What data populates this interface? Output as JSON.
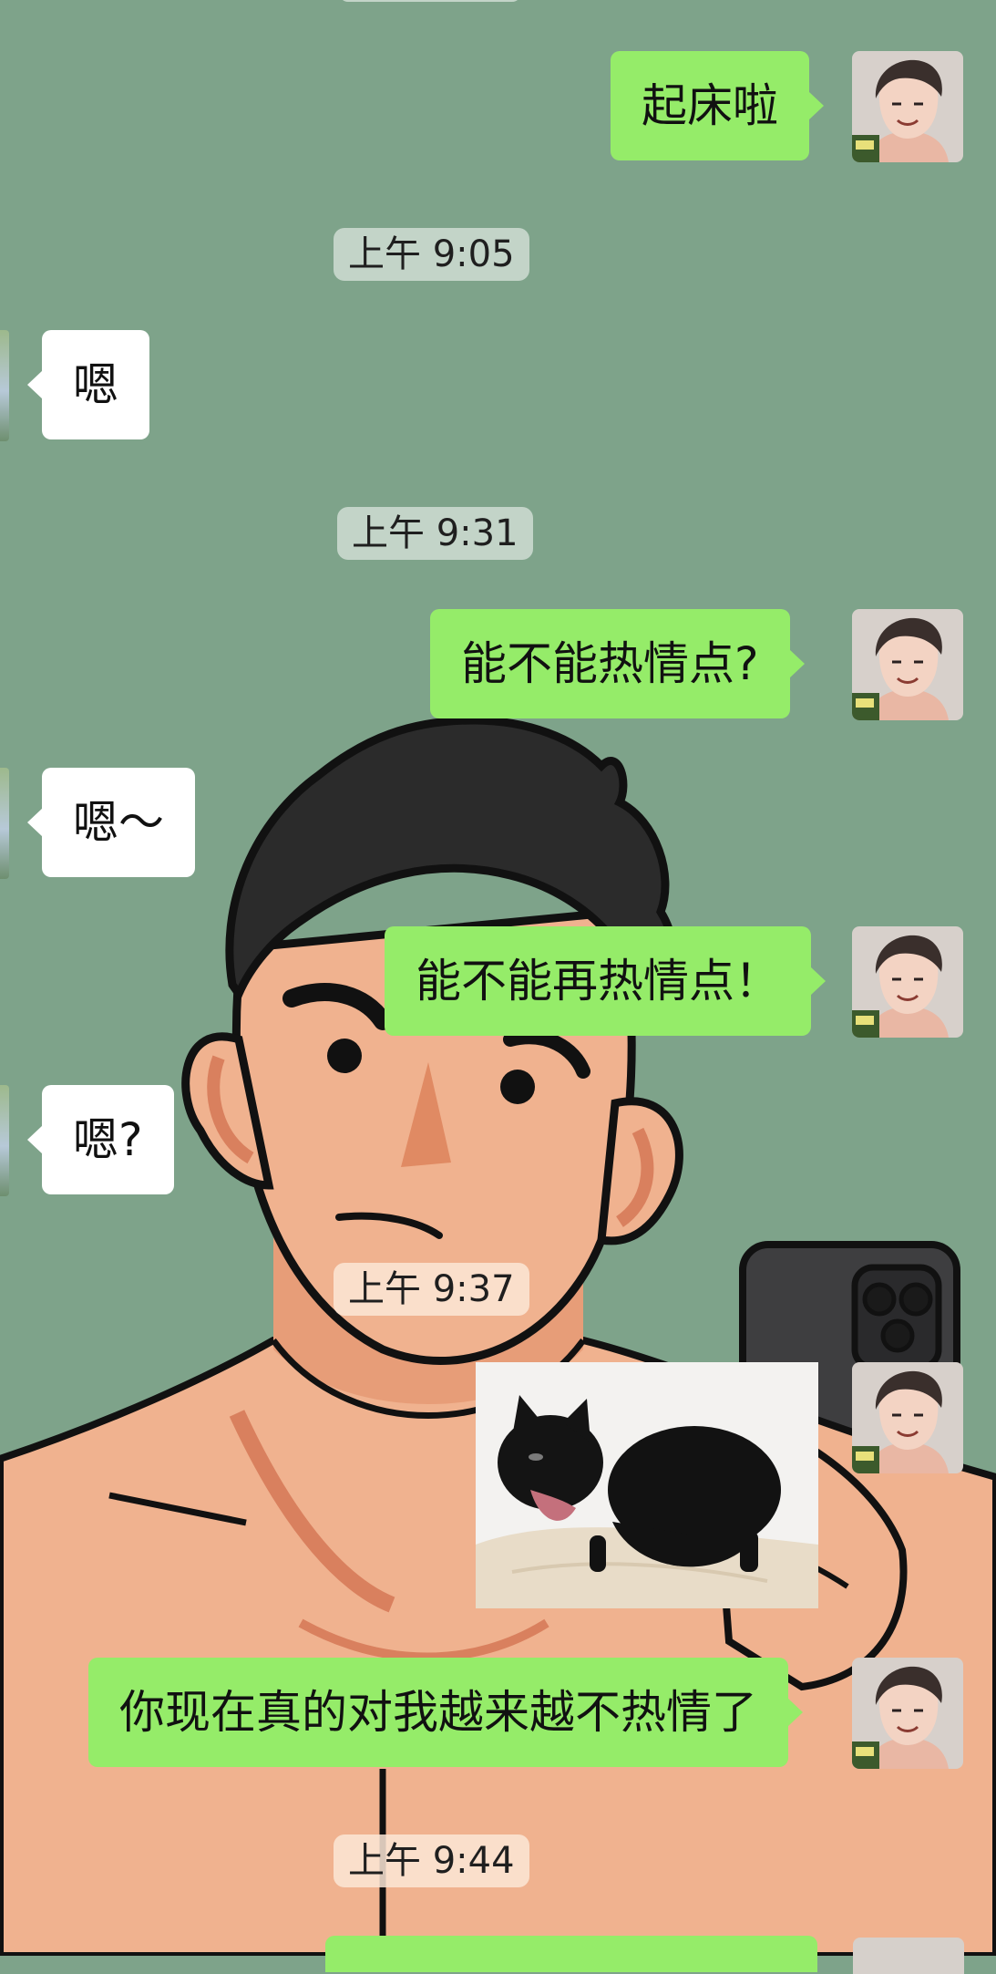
{
  "chat": {
    "messages": [
      {
        "kind": "outgoing",
        "text": "起床啦"
      },
      {
        "kind": "time",
        "text": "上午 9:05"
      },
      {
        "kind": "incoming",
        "text": "嗯"
      },
      {
        "kind": "time",
        "text": "上午 9:31"
      },
      {
        "kind": "outgoing",
        "text": "能不能热情点?"
      },
      {
        "kind": "incoming",
        "text": "嗯～"
      },
      {
        "kind": "outgoing",
        "text": "能不能再热情点！"
      },
      {
        "kind": "incoming",
        "text": "嗯?"
      },
      {
        "kind": "time",
        "text": "上午 9:37"
      },
      {
        "kind": "outgoing-image",
        "image": "black-cat-yawning-sticker"
      },
      {
        "kind": "outgoing",
        "text": "你现在真的对我越来越不热情了"
      },
      {
        "kind": "time",
        "text": "上午 9:44"
      }
    ]
  },
  "theme": {
    "wallpaper_bg": "#7ea38a",
    "outgoing_bubble": "#95ec69",
    "incoming_bubble": "#ffffff",
    "skin": "#f0b28f"
  }
}
